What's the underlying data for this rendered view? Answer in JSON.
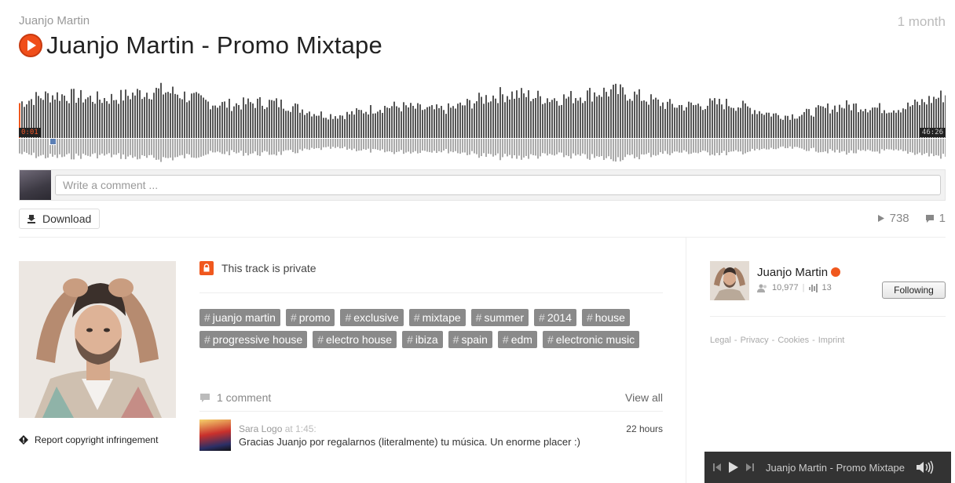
{
  "header": {
    "artist": "Juanjo Martin",
    "posted": "1 month",
    "title": "Juanjo Martin - Promo Mixtape"
  },
  "player": {
    "current_time": "0:01",
    "total_time": "46:26",
    "played_fraction": 0.0004
  },
  "comment_box": {
    "placeholder": "Write a comment ..."
  },
  "actions": {
    "download_label": "Download",
    "plays": "738",
    "comments": "1"
  },
  "artwork": {
    "report_label": "Report copyright infringement"
  },
  "track": {
    "private_label": "This track is private",
    "tags": [
      "juanjo martin",
      "promo",
      "exclusive",
      "mixtape",
      "summer",
      "2014",
      "house",
      "progressive house",
      "electro house",
      "ibiza",
      "spain",
      "edm",
      "electronic music"
    ]
  },
  "comments": {
    "count_label": "1 comment",
    "view_all": "View all",
    "items": [
      {
        "user": "Sara Logo",
        "at": "at 1:45:",
        "age": "22 hours",
        "text": "Gracias Juanjo por regalarnos (literalmente) tu música. Un enorme placer :)"
      }
    ]
  },
  "sidebar": {
    "name": "Juanjo Martin",
    "followers": "10,977",
    "tracks": "13",
    "follow_button": "Following",
    "footer_links": [
      "Legal",
      "Privacy",
      "Cookies",
      "Imprint"
    ],
    "footer_separator": "-"
  },
  "mini_player": {
    "title": "Juanjo Martin - Promo Mixtape"
  },
  "colors": {
    "accent": "#f0581e",
    "waveform_top": "#555555",
    "waveform_bottom": "#aaaaaa",
    "tag_bg": "#8a8a8a"
  }
}
